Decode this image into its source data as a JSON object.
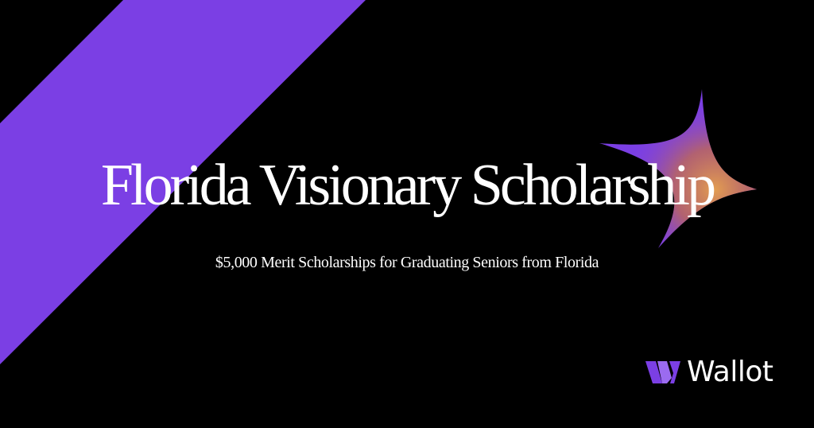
{
  "banner": {
    "title": "Florida Visionary Scholarship",
    "subtitle": "$5,000 Merit Scholarships for Graduating Seniors from Florida",
    "brand_name": "Wallot",
    "icons": [
      "diagonal-stripe",
      "sparkle-icon",
      "wallot-logo-icon"
    ],
    "colors": {
      "background": "#000000",
      "accent": "#7B3FE4",
      "sparkle_glow": "#E8A24A",
      "text": "#FFFFFF"
    }
  }
}
